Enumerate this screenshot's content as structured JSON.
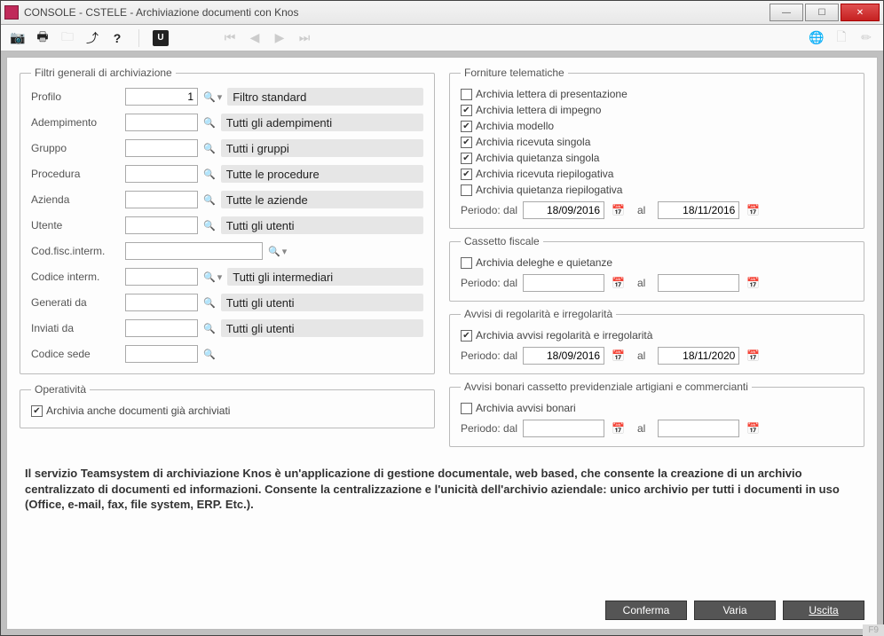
{
  "window": {
    "title": "CONSOLE  - CSTELE -  Archiviazione documenti con Knos"
  },
  "filters": {
    "legend": "Filtri generali di archiviazione",
    "profilo": {
      "label": "Profilo",
      "value": "1",
      "desc": "Filtro standard"
    },
    "adempimento": {
      "label": "Adempimento",
      "value": "",
      "desc": "Tutti gli adempimenti"
    },
    "gruppo": {
      "label": "Gruppo",
      "value": "",
      "desc": "Tutti i gruppi"
    },
    "procedura": {
      "label": "Procedura",
      "value": "",
      "desc": "Tutte le procedure"
    },
    "azienda": {
      "label": "Azienda",
      "value": "",
      "desc": "Tutte le aziende"
    },
    "utente": {
      "label": "Utente",
      "value": "",
      "desc": "Tutti gli utenti"
    },
    "codfisc": {
      "label": "Cod.fisc.interm.",
      "value": ""
    },
    "codinterm": {
      "label": "Codice interm.",
      "value": "",
      "desc": "Tutti gli intermediari"
    },
    "generati": {
      "label": "Generati da",
      "value": "",
      "desc": "Tutti gli utenti"
    },
    "inviati": {
      "label": "Inviati da",
      "value": "",
      "desc": "Tutti gli utenti"
    },
    "codsede": {
      "label": "Codice sede",
      "value": ""
    }
  },
  "operativita": {
    "legend": "Operatività",
    "chk": {
      "label": "Archivia anche documenti già archiviati",
      "checked": true
    }
  },
  "forniture": {
    "legend": "Forniture telematiche",
    "chks": [
      {
        "label": "Archivia lettera di presentazione",
        "checked": false
      },
      {
        "label": "Archivia lettera di impegno",
        "checked": true
      },
      {
        "label": "Archivia modello",
        "checked": true
      },
      {
        "label": "Archivia ricevuta singola",
        "checked": true
      },
      {
        "label": "Archivia quietanza singola",
        "checked": true
      },
      {
        "label": "Archivia ricevuta riepilogativa",
        "checked": true
      },
      {
        "label": "Archivia quietanza riepilogativa",
        "checked": false
      }
    ],
    "period_from_label": "Periodo: dal",
    "period_to_label": "al",
    "from": "18/09/2016",
    "to": "18/11/2016"
  },
  "cassetto": {
    "legend": "Cassetto fiscale",
    "chk": {
      "label": "Archivia deleghe e quietanze",
      "checked": false
    },
    "period_from_label": "Periodo: dal",
    "period_to_label": "al",
    "from": "",
    "to": ""
  },
  "avvisi": {
    "legend": "Avvisi di regolarità e irregolarità",
    "chk": {
      "label": "Archivia avvisi regolarità e irregolarità",
      "checked": true
    },
    "period_from_label": "Periodo: dal",
    "period_to_label": "al",
    "from": "18/09/2016",
    "to": "18/11/2020"
  },
  "bonari": {
    "legend": "Avvisi bonari cassetto previdenziale artigiani e commercianti",
    "chk": {
      "label": "Archivia avvisi bonari",
      "checked": false
    },
    "period_from_label": "Periodo: dal",
    "period_to_label": "al",
    "from": "",
    "to": ""
  },
  "description": "Il servizio Teamsystem di archiviazione Knos è un'applicazione di gestione documentale, web based, che consente la creazione di un archivio centralizzato di documenti ed informazioni. Consente la centralizzazione e l'unicità dell'archivio aziendale: unico archivio per tutti i documenti in uso (Office, e-mail, fax, file system, ERP. Etc.).",
  "buttons": {
    "conferma": "Conferma",
    "varia": "Varia",
    "uscita": "Uscita"
  },
  "status_hint": "F9"
}
